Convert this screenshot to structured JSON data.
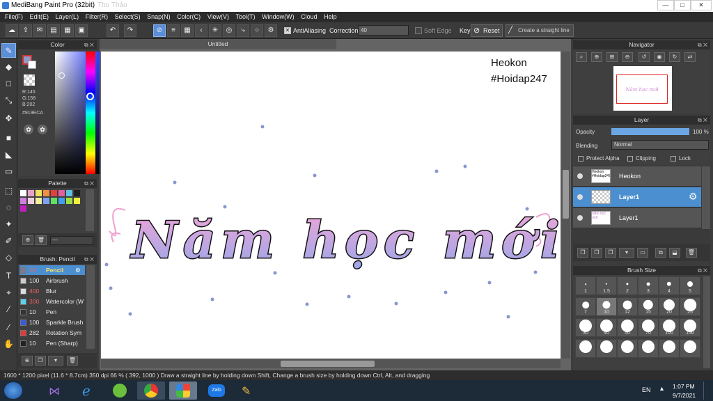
{
  "window": {
    "title": "MediBang Paint Pro (32bit)",
    "ghost_tab": "Tho Thảo",
    "min": "—",
    "max": "□",
    "close": "✕"
  },
  "menu": [
    "File(F)",
    "Edit(E)",
    "Layer(L)",
    "Filter(R)",
    "Select(S)",
    "Snap(N)",
    "Color(C)",
    "View(V)",
    "Tool(T)",
    "Window(W)",
    "Cloud",
    "Help"
  ],
  "toolbar": {
    "antialiasing": "AntiAliasing",
    "correction_label": "Correction",
    "correction_value": "40",
    "soft_edge": "Soft Edge",
    "key": "Key",
    "reset": "Reset",
    "straight_line": "Create a straight line"
  },
  "color_panel": {
    "title": "Color",
    "r": "R:145",
    "g": "G:158",
    "b": "B:202",
    "hex": "#919ECA",
    "current": "#919ECA"
  },
  "palette_panel": {
    "title": "Palette",
    "field": "---"
  },
  "brush_panel": {
    "title": "Brush: Pencil",
    "items": [
      {
        "size": "10",
        "name": "Pencil",
        "color": "#7a7a9a"
      },
      {
        "size": "100",
        "name": "Airbrush",
        "color": "#cccccc"
      },
      {
        "size": "400",
        "name": "Blur",
        "color": "#dddddd"
      },
      {
        "size": "300",
        "name": "Watercolor (W",
        "color": "#5ad2f0"
      },
      {
        "size": "10",
        "name": "Pen",
        "color": "#333333"
      },
      {
        "size": "100",
        "name": "Sparkle Brush",
        "color": "#3a5adf"
      },
      {
        "size": "282",
        "name": "Rotation Sym",
        "color": "#e23a3a"
      },
      {
        "size": "10",
        "name": "Pen (Sharp)",
        "color": "#222222"
      }
    ]
  },
  "document": {
    "tab": "Untitled",
    "watermark_line1": "Heokon",
    "watermark_line2": "#Hoidap247",
    "lettering": "Năm học mới"
  },
  "navigator": {
    "title": "Navigator",
    "thumb_text": "Năm học mới"
  },
  "layer_panel": {
    "title": "Layer",
    "opacity_label": "Opacity",
    "opacity_value": "100 %",
    "opacity_fraction": 1.0,
    "blending_label": "Blending",
    "blending_value": "Normal",
    "protect_alpha": "Protect Alpha",
    "clipping": "Clipping",
    "lock": "Lock",
    "layers": [
      {
        "name": "Heokon",
        "thumb": "Heokon #Hoidap247"
      },
      {
        "name": "Layer1",
        "thumb": ""
      },
      {
        "name": "Layer1",
        "thumb": "Năm học mới"
      }
    ]
  },
  "brush_size_panel": {
    "title": "Brush Size",
    "sizes": [
      "1",
      "1.5",
      "2",
      "3",
      "4",
      "5",
      "7",
      "10",
      "12",
      "15",
      "20",
      "25",
      "30",
      "40",
      "50",
      "70",
      "100",
      "150",
      "",
      "",
      "",
      "",
      "",
      ""
    ]
  },
  "status": {
    "text": "1600 * 1200 pixel  (11.6 * 8.7cm)  350 dpi  66 %  ( 392, 1000 )  Draw a straight line by holding down Shift, Change a brush size by holding down Ctrl, Alt, and dragging"
  },
  "taskbar": {
    "lang": "EN",
    "time": "1:07 PM",
    "date": "9/7/2021",
    "zalo": "Zalo"
  },
  "colors": {
    "accent": "#5b8fd8",
    "lettering_pink": "#e8a0d8",
    "lettering_purple": "#9aa6e8",
    "dots": "#8a97cc"
  }
}
